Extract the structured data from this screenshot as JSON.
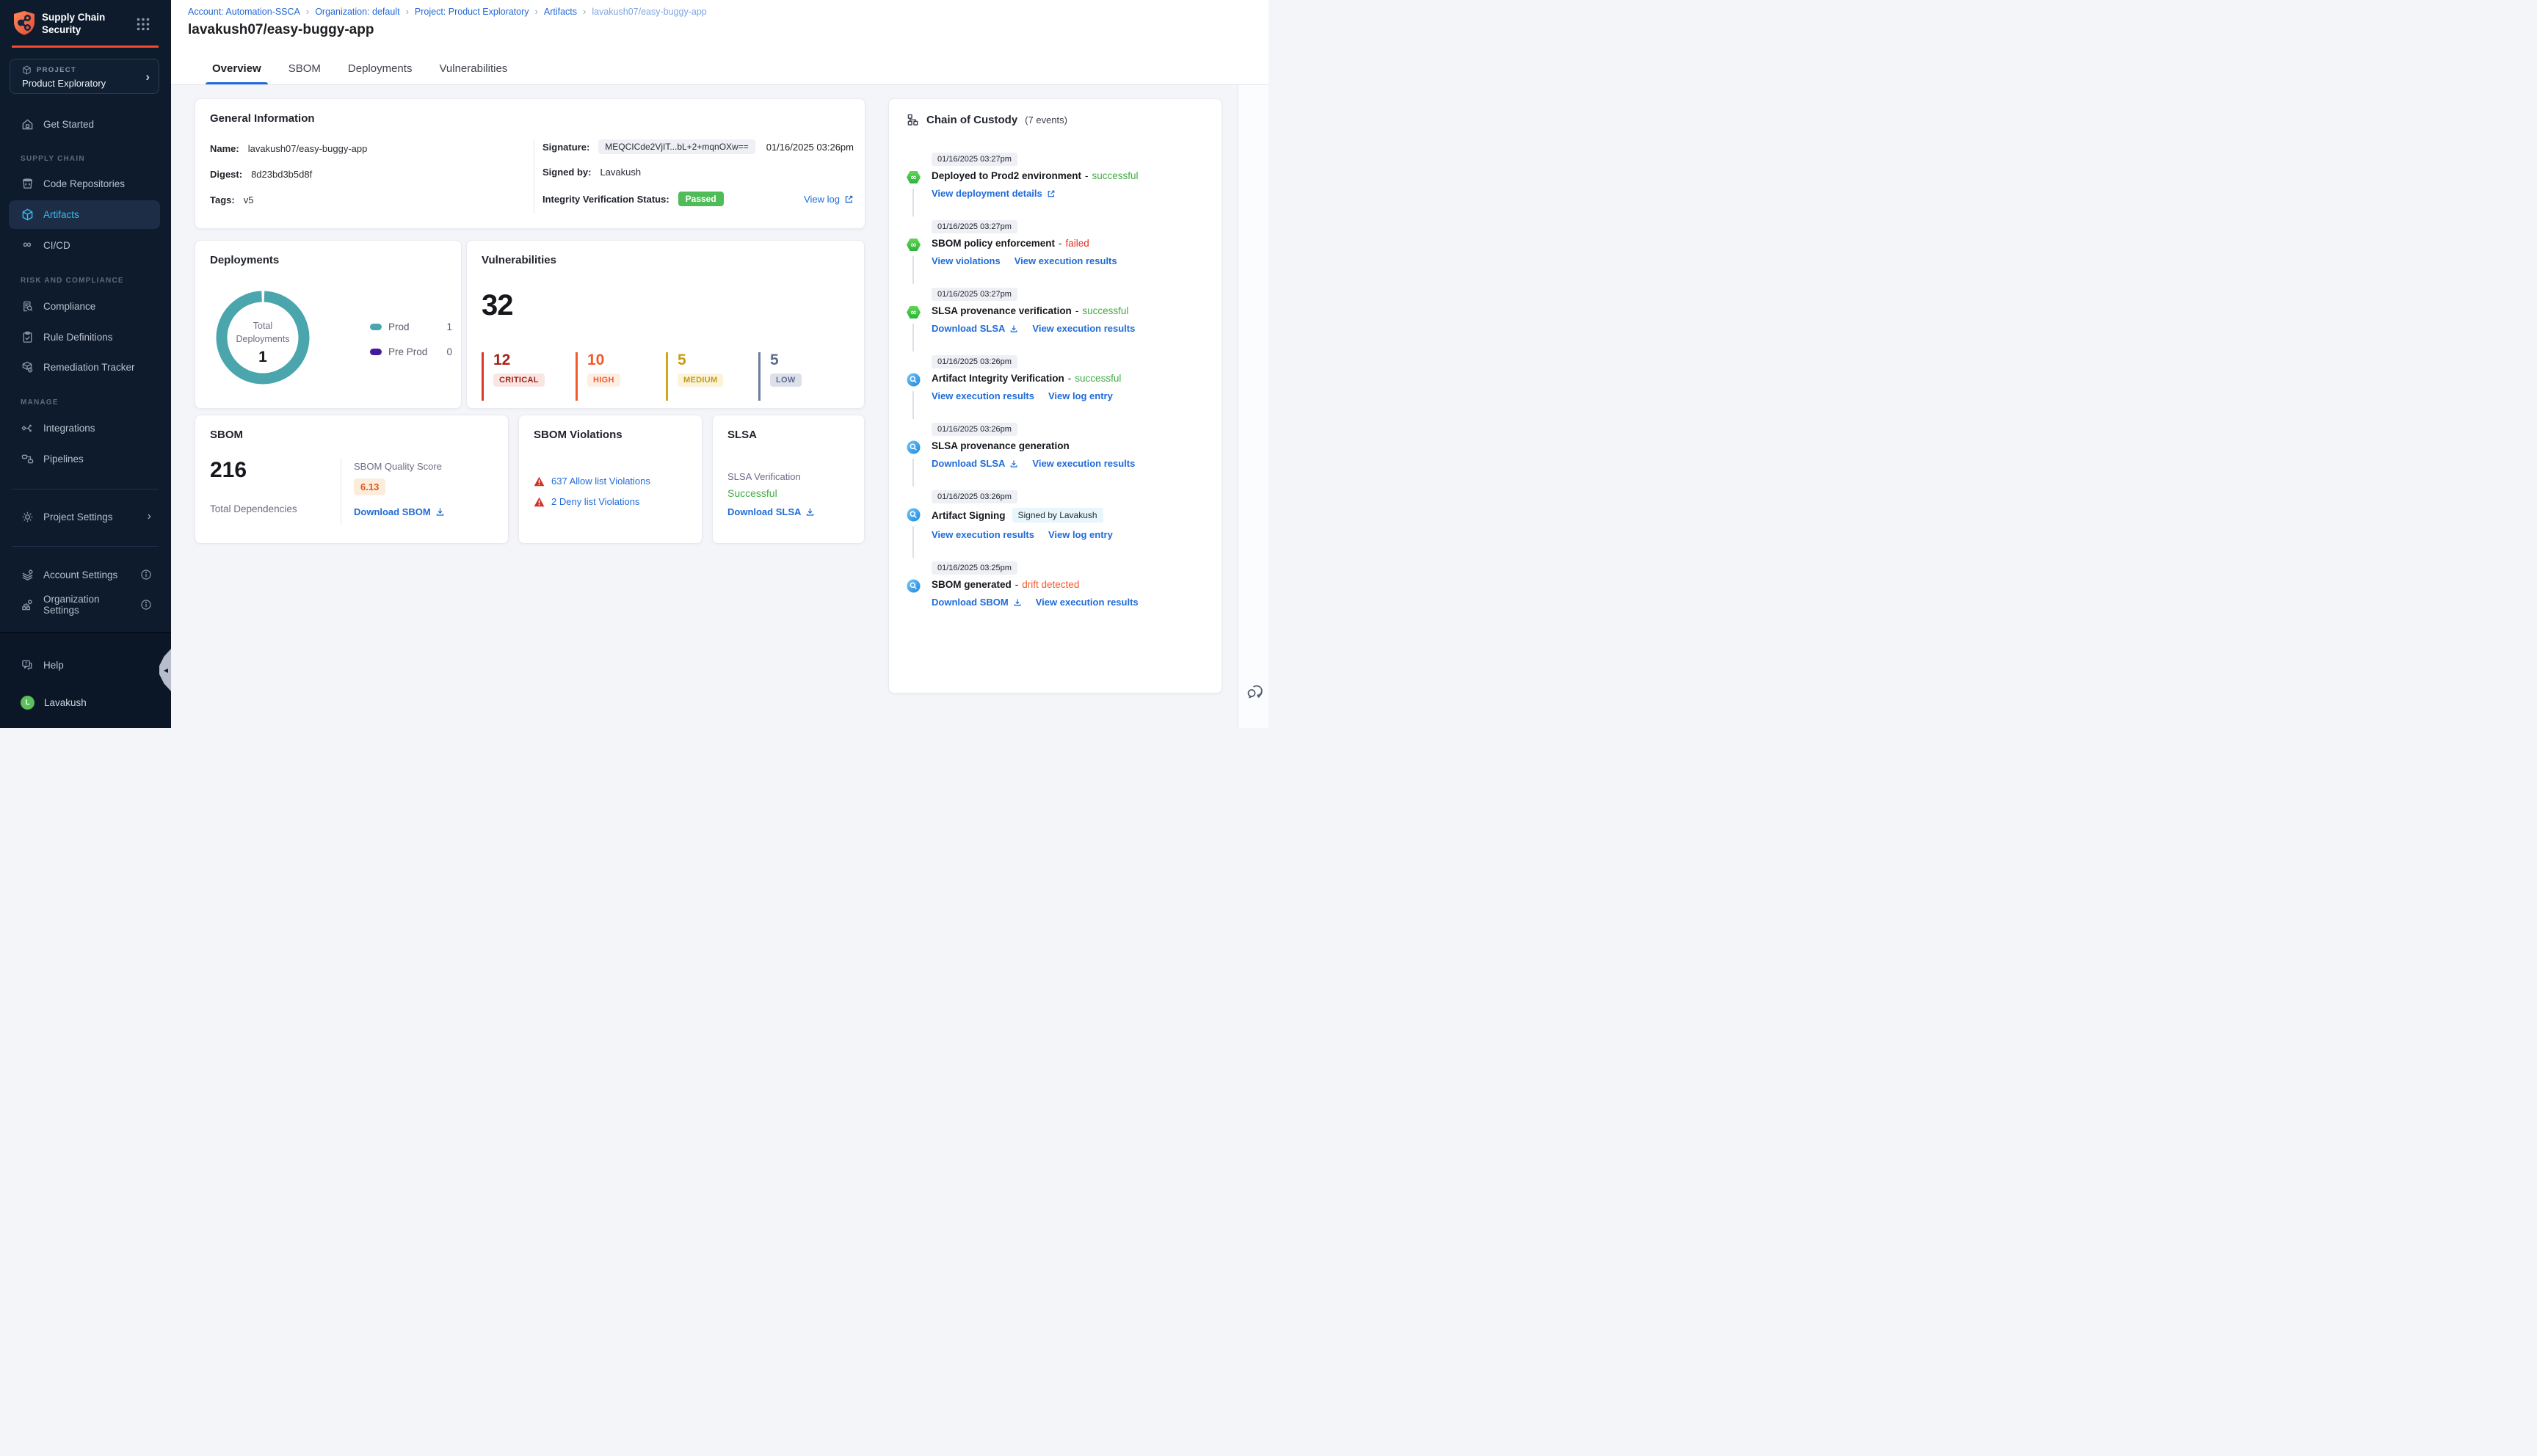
{
  "app": {
    "title1": "Supply Chain",
    "title2": "Security",
    "project_label": "PROJECT",
    "project_name": "Product Exploratory",
    "user": "Lavakush",
    "user_initial": "L",
    "help": "Help"
  },
  "sidebar": {
    "get_started": "Get Started",
    "section_supply_chain": "SUPPLY CHAIN",
    "code_repositories": "Code Repositories",
    "artifacts": "Artifacts",
    "cicd": "CI/CD",
    "section_risk": "RISK AND COMPLIANCE",
    "compliance": "Compliance",
    "rule_definitions": "Rule Definitions",
    "remediation_tracker": "Remediation Tracker",
    "section_manage": "MANAGE",
    "integrations": "Integrations",
    "pipelines": "Pipelines",
    "project_settings": "Project Settings",
    "account_settings": "Account Settings",
    "organization_settings": "Organization Settings"
  },
  "breadcrumb": {
    "items": [
      "Account: Automation-SSCA",
      "Organization: default",
      "Project: Product Exploratory",
      "Artifacts",
      "lavakush07/easy-buggy-app"
    ]
  },
  "page": {
    "title": "lavakush07/easy-buggy-app"
  },
  "tabs": [
    "Overview",
    "SBOM",
    "Deployments",
    "Vulnerabilities"
  ],
  "general_info": {
    "title": "General Information",
    "name_label": "Name:",
    "name": "lavakush07/easy-buggy-app",
    "digest_label": "Digest:",
    "digest": "8d23bd3b5d8f",
    "tags_label": "Tags:",
    "tags": "v5",
    "signature_label": "Signature:",
    "signature": "MEQCICde2VjIT...bL+2+mqnOXw==",
    "signature_time": "01/16/2025 03:26pm",
    "signed_by_label": "Signed by:",
    "signed_by": "Lavakush",
    "integrity_label": "Integrity Verification Status:",
    "integrity_status": "Passed",
    "view_log": "View log"
  },
  "deployments": {
    "title": "Deployments",
    "center_label1": "Total",
    "center_label2": "Deployments",
    "total": "1",
    "legend": [
      {
        "label": "Prod",
        "value": "1",
        "color": "#4aa5ad"
      },
      {
        "label": "Pre Prod",
        "value": "0",
        "color": "#45189c"
      }
    ]
  },
  "vulnerabilities": {
    "title": "Vulnerabilities",
    "total": "32",
    "items": [
      {
        "count": "12",
        "label": "CRITICAL",
        "color": "#a1241b"
      },
      {
        "count": "10",
        "label": "HIGH",
        "color": "#f4592a"
      },
      {
        "count": "5",
        "label": "MEDIUM",
        "color": "#c79c10"
      },
      {
        "count": "5",
        "label": "LOW",
        "color": "#5d6d8c"
      }
    ]
  },
  "sbom": {
    "title": "SBOM",
    "total": "216",
    "total_label": "Total Dependencies",
    "score_label": "SBOM Quality Score",
    "score": "6.13",
    "download": "Download SBOM"
  },
  "sbom_violations": {
    "title": "SBOM Violations",
    "allow": "637 Allow list Violations",
    "deny": "2 Deny list Violations"
  },
  "slsa": {
    "title": "SLSA",
    "verification_label": "SLSA Verification",
    "status": "Successful",
    "download": "Download SLSA"
  },
  "chain": {
    "title": "Chain of Custody",
    "events_count": "(7 events)",
    "events": [
      {
        "time": "01/16/2025 03:27pm",
        "title": "Deployed to Prod2 environment",
        "sep": "-",
        "status": "successful",
        "links": [
          {
            "label": "View deployment details"
          }
        ]
      },
      {
        "time": "01/16/2025 03:27pm",
        "title": "SBOM policy enforcement",
        "sep": "-",
        "status": "failed",
        "links": [
          {
            "label": "View violations"
          },
          {
            "label": "View execution results"
          }
        ]
      },
      {
        "time": "01/16/2025 03:27pm",
        "title": "SLSA provenance verification",
        "sep": "-",
        "status": "successful",
        "links": [
          {
            "label": "Download SLSA"
          },
          {
            "label": "View execution results"
          }
        ]
      },
      {
        "time": "01/16/2025 03:26pm",
        "title": "Artifact Integrity Verification",
        "sep": "-",
        "status": "successful",
        "links": [
          {
            "label": "View execution results"
          },
          {
            "label": "View log entry"
          }
        ]
      },
      {
        "time": "01/16/2025 03:26pm",
        "title": "SLSA provenance generation",
        "links": [
          {
            "label": "Download SLSA"
          },
          {
            "label": "View execution results"
          }
        ]
      },
      {
        "time": "01/16/2025 03:26pm",
        "title": "Artifact Signing",
        "badge": "Signed by Lavakush",
        "links": [
          {
            "label": "View execution results"
          },
          {
            "label": "View log entry"
          }
        ]
      },
      {
        "time": "01/16/2025 03:25pm",
        "title": "SBOM generated",
        "sep": "-",
        "status": "drift detected",
        "links": [
          {
            "label": "Download SBOM"
          },
          {
            "label": "View execution results"
          }
        ]
      }
    ]
  },
  "colors": {
    "brand_orange": "#f4492e",
    "link_blue": "#1f6bd8",
    "success_green": "#42ab45",
    "failed_red": "#e23121",
    "drift_orange": "#f4592a",
    "donut_teal": "#4aa5ad",
    "preprod_purple": "#45189c",
    "sidebar_bg": "#0d1b2d"
  }
}
